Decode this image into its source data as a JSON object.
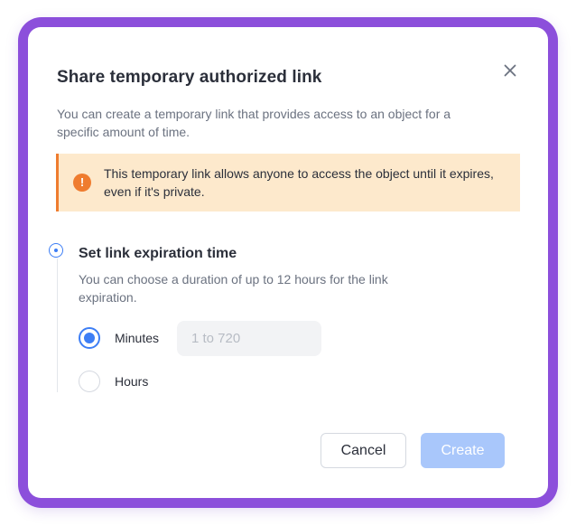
{
  "dialog": {
    "title": "Share temporary authorized link",
    "description": "You can create a temporary link that provides access to an object for a specific amount of time.",
    "close_icon": "close-icon"
  },
  "warning": {
    "icon": "exclamation-circle-icon",
    "icon_glyph": "!",
    "text": "This temporary link allows anyone to access the object until it expires, even if it's private.",
    "color": "#ef7c2f",
    "background": "#fde9cc"
  },
  "expiration": {
    "title": "Set link expiration time",
    "description": "You can choose a duration of up to 12 hours for the link expiration.",
    "options": [
      {
        "label": "Minutes",
        "selected": true
      },
      {
        "label": "Hours",
        "selected": false
      }
    ],
    "minutes_input": {
      "value": "",
      "placeholder": "1 to 720"
    }
  },
  "actions": {
    "cancel_label": "Cancel",
    "create_label": "Create"
  },
  "colors": {
    "frame": "#8c4fdb",
    "accent": "#3d7ef5",
    "create_disabled": "#a9c7fb"
  }
}
